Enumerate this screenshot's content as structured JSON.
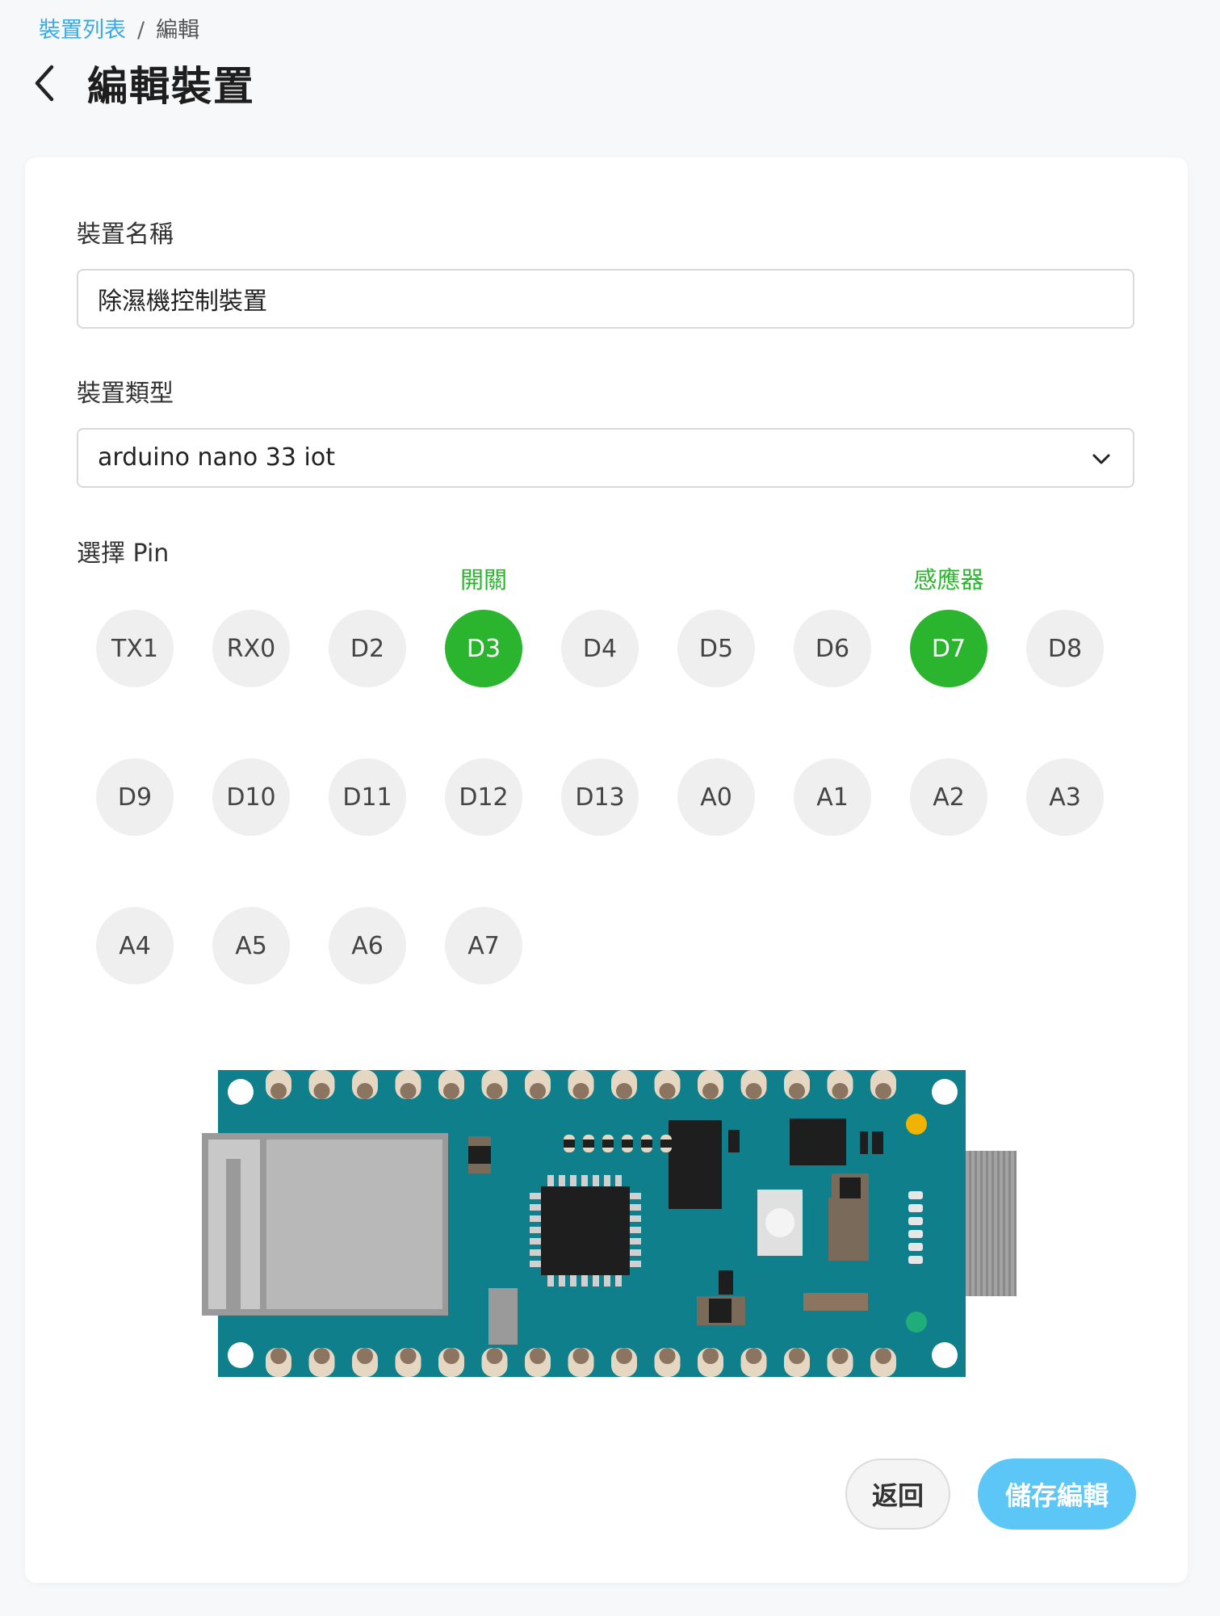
{
  "breadcrumb": {
    "parent": "裝置列表",
    "separator": "/",
    "current": "編輯"
  },
  "page": {
    "title": "編輯裝置"
  },
  "form": {
    "name_label": "裝置名稱",
    "name_value": "除濕機控制裝置",
    "type_label": "裝置類型",
    "type_value": "arduino nano 33 iot",
    "pin_label": "選擇 Pin"
  },
  "pins": [
    {
      "label": "TX1",
      "selected": false
    },
    {
      "label": "RX0",
      "selected": false
    },
    {
      "label": "D2",
      "selected": false
    },
    {
      "label": "D3",
      "selected": true,
      "tag": "開關"
    },
    {
      "label": "D4",
      "selected": false
    },
    {
      "label": "D5",
      "selected": false
    },
    {
      "label": "D6",
      "selected": false
    },
    {
      "label": "D7",
      "selected": true,
      "tag": "感應器"
    },
    {
      "label": "D8",
      "selected": false
    },
    {
      "label": "D9",
      "selected": false
    },
    {
      "label": "D10",
      "selected": false
    },
    {
      "label": "D11",
      "selected": false
    },
    {
      "label": "D12",
      "selected": false
    },
    {
      "label": "D13",
      "selected": false
    },
    {
      "label": "A0",
      "selected": false
    },
    {
      "label": "A1",
      "selected": false
    },
    {
      "label": "A2",
      "selected": false
    },
    {
      "label": "A3",
      "selected": false
    },
    {
      "label": "A4",
      "selected": false
    },
    {
      "label": "A5",
      "selected": false
    },
    {
      "label": "A6",
      "selected": false
    },
    {
      "label": "A7",
      "selected": false
    }
  ],
  "actions": {
    "back_label": "返回",
    "save_label": "儲存編輯"
  },
  "colors": {
    "accent": "#5cc6f6",
    "selected_pin": "#2bb52f",
    "link": "#3aa9e6",
    "board": "#0f7f8c"
  },
  "icons": {
    "back": "chevron-left-icon",
    "select": "chevron-down-icon"
  }
}
